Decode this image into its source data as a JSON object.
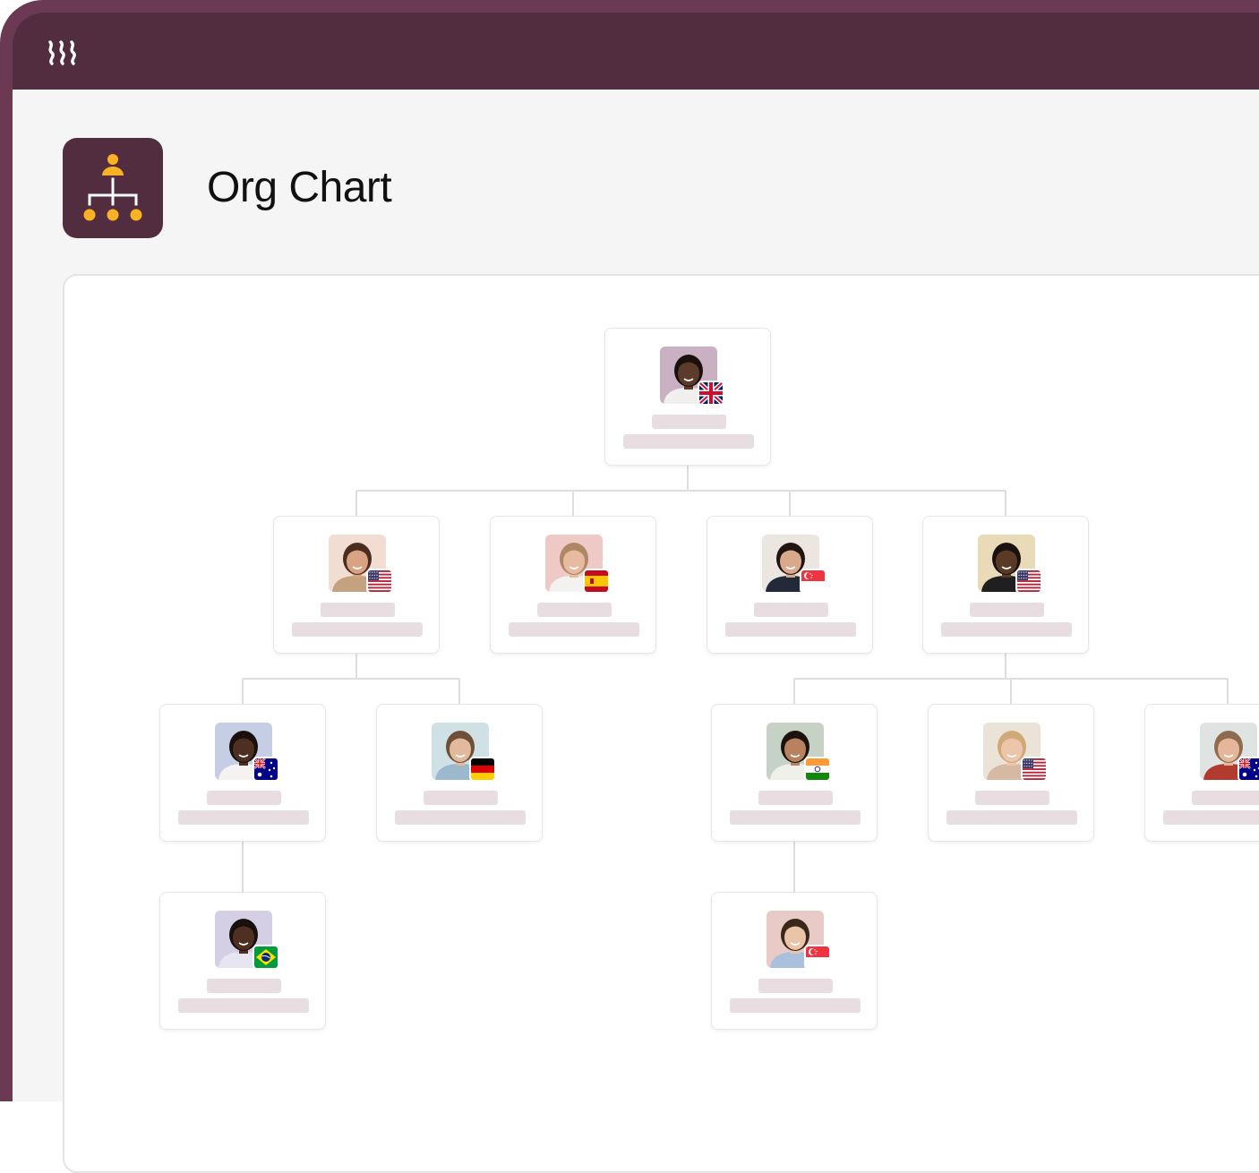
{
  "app": {
    "logo_icon": "brand-logo-icon",
    "title_icon": "org-chart-icon",
    "title": "Org Chart"
  },
  "colors": {
    "brand_dark": "#522d3f",
    "brand_frame": "#6b3a52",
    "accent": "#fbb124",
    "placeholder": "#e8dde1",
    "connector": "#dedede"
  },
  "org_chart": {
    "nodes": [
      {
        "id": "root",
        "parent": null,
        "flag": "uk",
        "skin": "#5c3b2a",
        "hair": "#1b110c",
        "shirt": "#f1efed",
        "bg": "#c9b1c3"
      },
      {
        "id": "m1",
        "parent": "root",
        "flag": "usa",
        "skin": "#d9a383",
        "hair": "#4a2d1f",
        "shirt": "#c4a17f",
        "bg": "#f2ddd2"
      },
      {
        "id": "m2",
        "parent": "root",
        "flag": "spain",
        "skin": "#e6bba0",
        "hair": "#b08766",
        "shirt": "#f4f2f0",
        "bg": "#eec9c6"
      },
      {
        "id": "m3",
        "parent": "root",
        "flag": "singapore",
        "skin": "#d9a98b",
        "hair": "#20150f",
        "shirt": "#222a3a",
        "bg": "#ebe7e0"
      },
      {
        "id": "m4",
        "parent": "root",
        "flag": "usa",
        "skin": "#5a3a27",
        "hair": "#1a1210",
        "shirt": "#1f1f1f",
        "bg": "#eadbb8"
      },
      {
        "id": "e1",
        "parent": "m1",
        "flag": "australia",
        "skin": "#4e3022",
        "hair": "#1a100b",
        "shirt": "#f5f3f1",
        "bg": "#c6cee6"
      },
      {
        "id": "e2",
        "parent": "m1",
        "flag": "germany",
        "skin": "#e3b99e",
        "hair": "#6e5038",
        "shirt": "#9cb8cc",
        "bg": "#cfe1e4"
      },
      {
        "id": "e3",
        "parent": "m4",
        "flag": "india",
        "skin": "#b9825f",
        "hair": "#1c130e",
        "shirt": "#f0f0ea",
        "bg": "#c6d2c6"
      },
      {
        "id": "e4",
        "parent": "m4",
        "flag": "usa",
        "skin": "#ecc5aa",
        "hair": "#cfa978",
        "shirt": "#d6b9a3",
        "bg": "#ebe2d8"
      },
      {
        "id": "e5",
        "parent": "m4",
        "flag": "australia",
        "skin": "#e5b69a",
        "hair": "#8e6a4e",
        "shirt": "#b33a2e",
        "bg": "#dfe4e2"
      },
      {
        "id": "s1",
        "parent": "e1",
        "flag": "brazil",
        "skin": "#4f2f22",
        "hair": "#1a100b",
        "shirt": "#e7e5f2",
        "bg": "#d5cfe6"
      },
      {
        "id": "s2",
        "parent": "e3",
        "flag": "singapore",
        "skin": "#ebc3a6",
        "hair": "#3a261b",
        "shirt": "#a9c0de",
        "bg": "#e8cbc7"
      }
    ]
  }
}
